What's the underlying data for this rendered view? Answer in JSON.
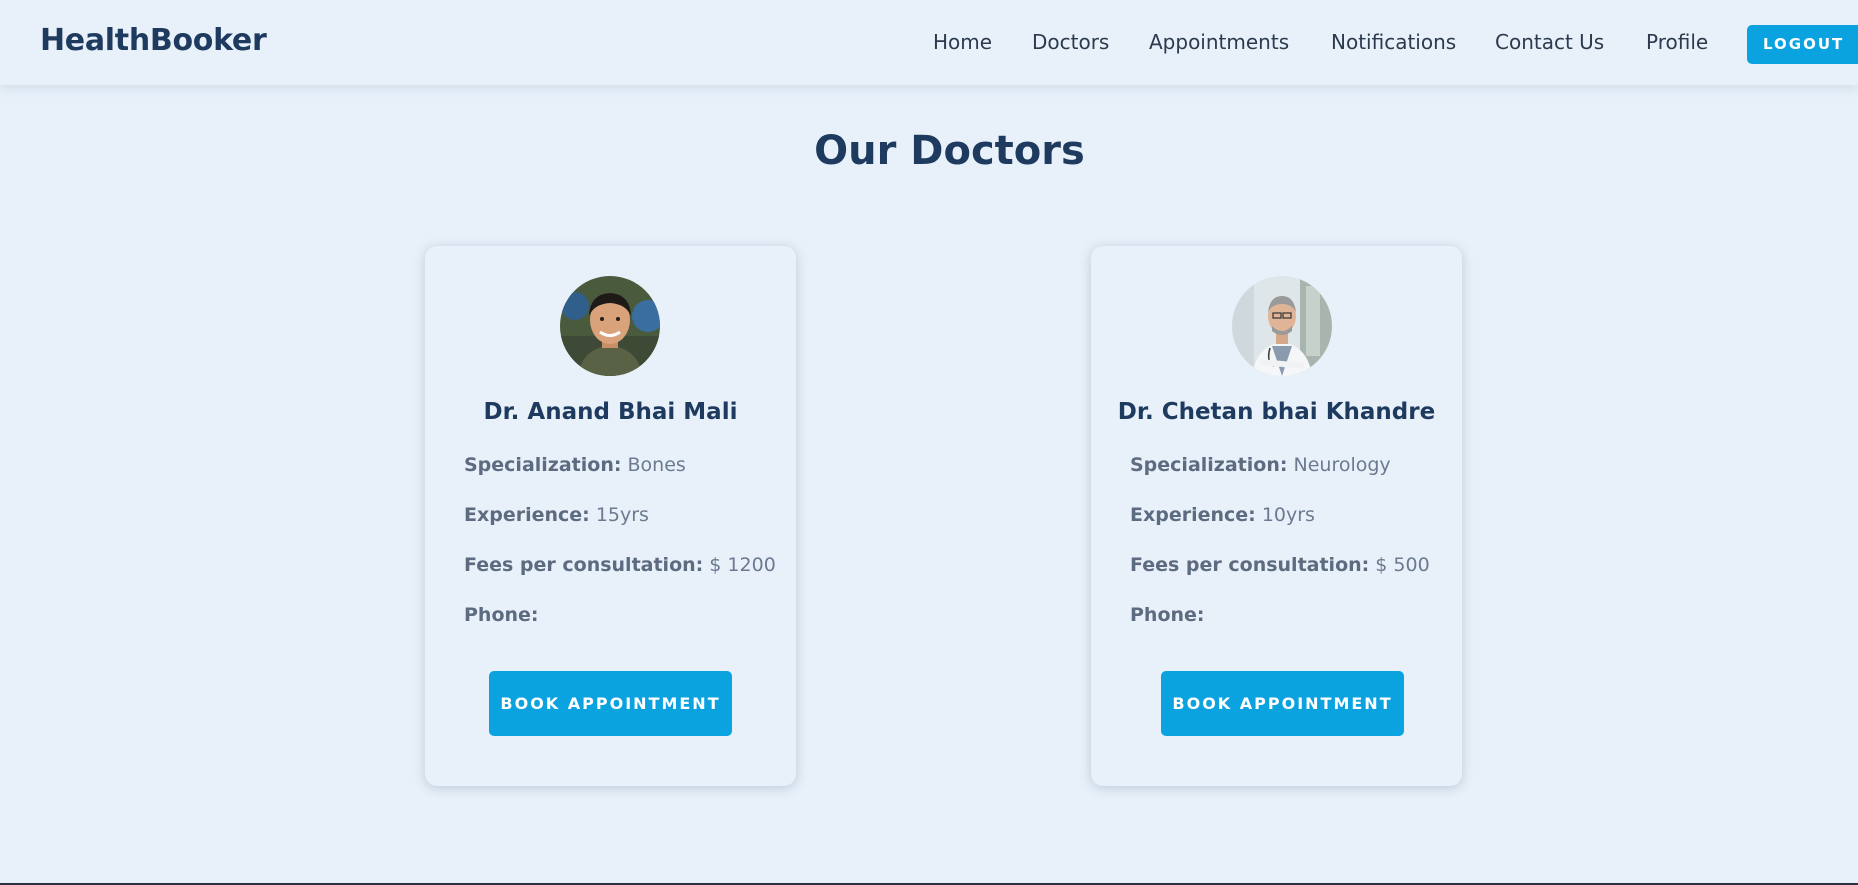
{
  "app": {
    "brand": "HealthBooker"
  },
  "nav": {
    "items": [
      {
        "label": "Home"
      },
      {
        "label": "Doctors"
      },
      {
        "label": "Appointments"
      },
      {
        "label": "Notifications"
      },
      {
        "label": "Contact Us"
      },
      {
        "label": "Profile"
      }
    ],
    "logout_label": "LOGOUT"
  },
  "page": {
    "title": "Our Doctors"
  },
  "labels": {
    "specialization": "Specialization:",
    "experience": "Experience:",
    "fees": "Fees per consultation:",
    "phone": "Phone:"
  },
  "doctors": [
    {
      "name": "Dr. Anand Bhai Mali",
      "specialization": "Bones",
      "experience": "15yrs",
      "fees": "$ 1200",
      "phone": "",
      "book_label": "BOOK APPOINTMENT"
    },
    {
      "name": "Dr. Chetan bhai Khandre",
      "specialization": "Neurology",
      "experience": "10yrs",
      "fees": "$ 500",
      "phone": "",
      "book_label": "BOOK APPOINTMENT"
    }
  ],
  "colors": {
    "background": "#e8f1fa",
    "primary": "#0aa3e0",
    "heading": "#1e3a5f",
    "text": "#6b7a90"
  }
}
